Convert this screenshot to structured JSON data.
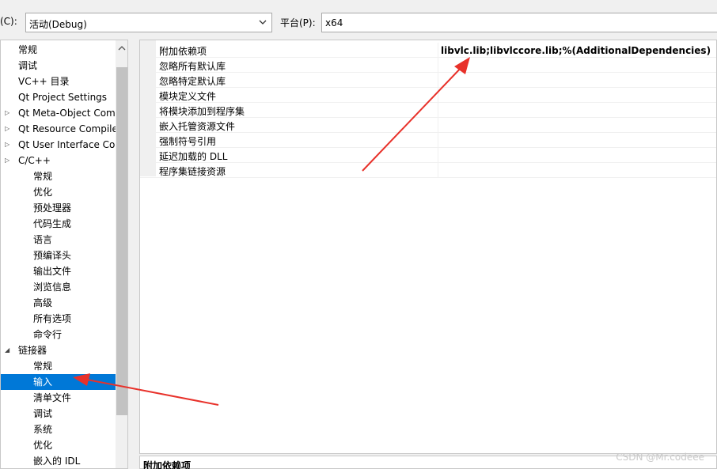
{
  "toolbar": {
    "config_label_suffix": "(C):",
    "config_label_key": "C",
    "config_value": "活动(Debug)",
    "platform_label": "平台(P):",
    "platform_value": "x64"
  },
  "tree": {
    "items": [
      {
        "label": "常规",
        "level": 1
      },
      {
        "label": "调试",
        "level": 1
      },
      {
        "label": "VC++ 目录",
        "level": 1
      },
      {
        "label": "Qt Project Settings",
        "level": 1
      },
      {
        "label": "Qt Meta-Object Com",
        "level": 1,
        "twisty": "collapsed"
      },
      {
        "label": "Qt Resource Compile",
        "level": 1,
        "twisty": "collapsed"
      },
      {
        "label": "Qt User Interface Co",
        "level": 1,
        "twisty": "collapsed"
      },
      {
        "label": "C/C++",
        "level": 1,
        "twisty": "collapsed"
      },
      {
        "label": "常规",
        "level": 2
      },
      {
        "label": "优化",
        "level": 2
      },
      {
        "label": "预处理器",
        "level": 2
      },
      {
        "label": "代码生成",
        "level": 2
      },
      {
        "label": "语言",
        "level": 2
      },
      {
        "label": "预编译头",
        "level": 2
      },
      {
        "label": "输出文件",
        "level": 2
      },
      {
        "label": "浏览信息",
        "level": 2
      },
      {
        "label": "高级",
        "level": 2
      },
      {
        "label": "所有选项",
        "level": 2
      },
      {
        "label": "命令行",
        "level": 2
      },
      {
        "label": "链接器",
        "level": 1,
        "twisty": "expanded"
      },
      {
        "label": "常规",
        "level": 2
      },
      {
        "label": "输入",
        "level": 2,
        "selected": true
      },
      {
        "label": "清单文件",
        "level": 2
      },
      {
        "label": "调试",
        "level": 2
      },
      {
        "label": "系统",
        "level": 2
      },
      {
        "label": "优化",
        "level": 2
      },
      {
        "label": "嵌入的 IDL",
        "level": 2
      }
    ]
  },
  "properties": [
    {
      "name": "附加依赖项",
      "value": "libvlc.lib;libvlccore.lib;%(AdditionalDependencies)"
    },
    {
      "name": "忽略所有默认库",
      "value": ""
    },
    {
      "name": "忽略特定默认库",
      "value": ""
    },
    {
      "name": "模块定义文件",
      "value": ""
    },
    {
      "name": "将模块添加到程序集",
      "value": ""
    },
    {
      "name": "嵌入托管资源文件",
      "value": ""
    },
    {
      "name": "强制符号引用",
      "value": ""
    },
    {
      "name": "延迟加载的 DLL",
      "value": ""
    },
    {
      "name": "程序集链接资源",
      "value": ""
    }
  ],
  "description": {
    "title": "附加依赖项"
  },
  "watermark": "CSDN @Mr.codeee",
  "colors": {
    "selection": "#0078d7",
    "arrow": "#e8312a"
  }
}
